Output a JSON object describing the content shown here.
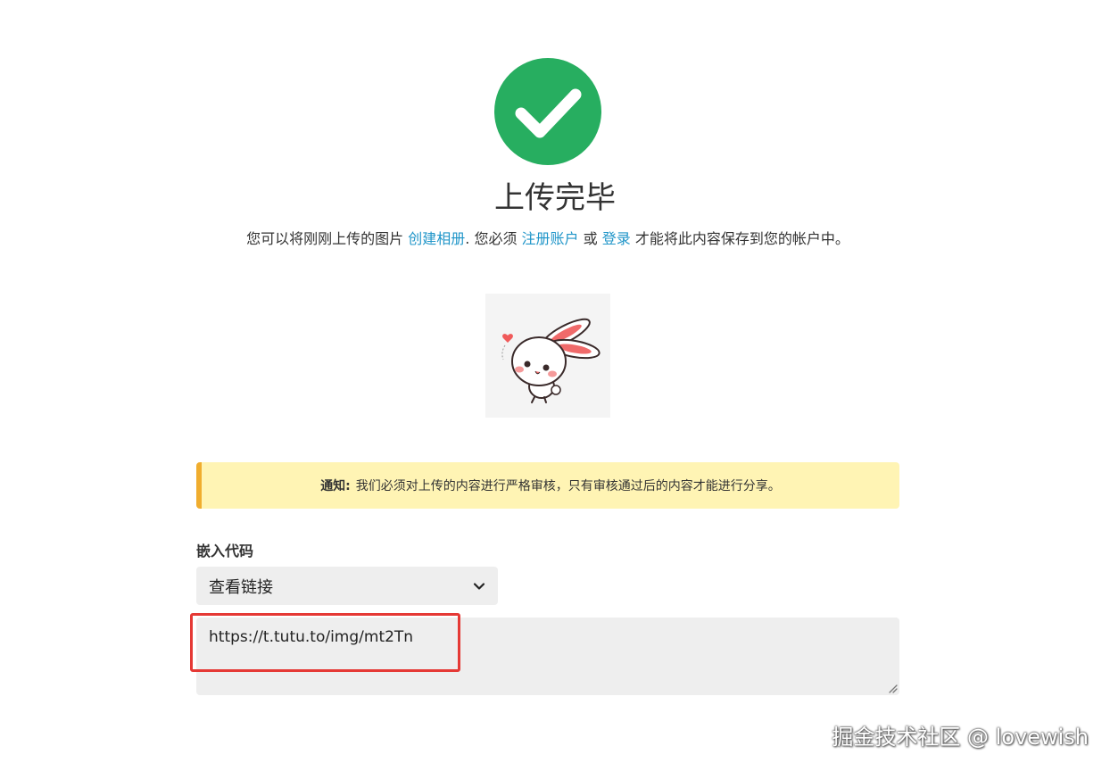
{
  "header": {
    "success_icon": "check-circle-icon",
    "success_color": "#27ae60",
    "title": "上传完毕"
  },
  "description": {
    "text_1": "您可以将刚刚上传的图片 ",
    "create_album_link": "创建相册",
    "text_2": ". 您必须 ",
    "register_link": "注册账户",
    "text_3": " 或 ",
    "login_link": "登录",
    "text_4": " 才能将此内容保存到您的帐户中。",
    "link_color": "#2196c9"
  },
  "thumbnail": {
    "alt": "bunny sticker"
  },
  "notice": {
    "label": "通知:",
    "message": "我们必须对上传的内容进行严格审核，只有审核通过后的内容才能进行分享。",
    "background": "#fff4b4",
    "accent": "#f0ad2e"
  },
  "embed": {
    "label": "嵌入代码",
    "select_value": "查看链接",
    "code_value": "https://t.tutu.to/img/mt2Tn"
  },
  "annotation": {
    "highlight_color": "#e53935"
  },
  "watermark": {
    "text": "掘金技术社区 @ lovewish"
  }
}
